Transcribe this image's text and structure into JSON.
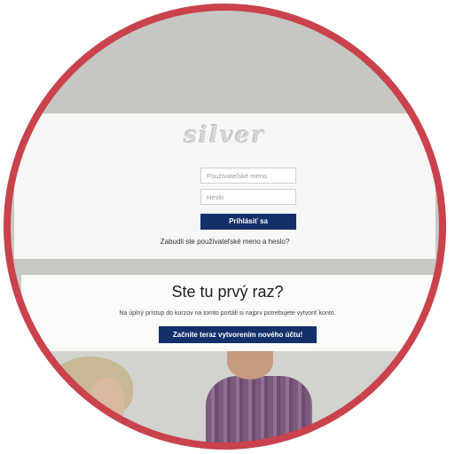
{
  "logo_text": "silver",
  "login": {
    "username_placeholder": "Používateľské meno",
    "password_placeholder": "Heslo",
    "submit_label": "Prihlásiť sa",
    "forgot_link": "Zabudli ste používateľské meno a heslo?"
  },
  "first_time": {
    "title": "Ste tu prvý raz?",
    "description": "Na úplný prístup do kurzov na tomto portáli si najprv potrebujete vytvoriť konto.",
    "create_account_label": "Začnite teraz vytvorením nového účtu!"
  },
  "colors": {
    "primary_button": "#14306a",
    "frame_ring": "#c9424c"
  }
}
